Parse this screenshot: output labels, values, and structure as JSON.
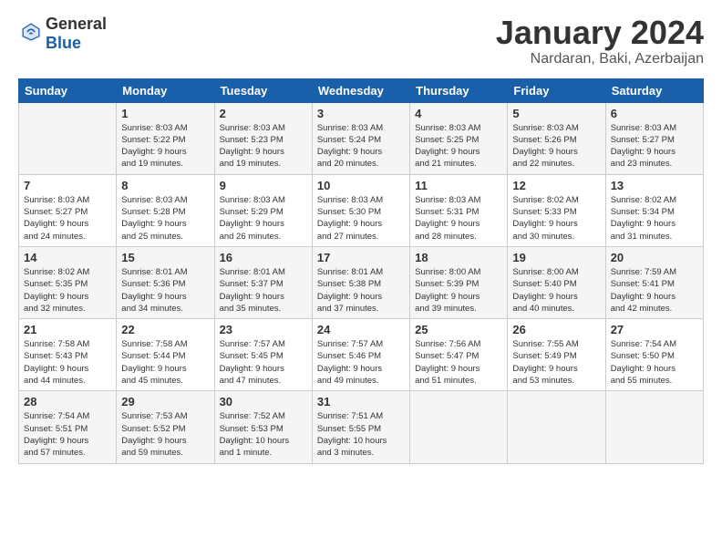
{
  "header": {
    "logo_general": "General",
    "logo_blue": "Blue",
    "month": "January 2024",
    "location": "Nardaran, Baki, Azerbaijan"
  },
  "weekdays": [
    "Sunday",
    "Monday",
    "Tuesday",
    "Wednesday",
    "Thursday",
    "Friday",
    "Saturday"
  ],
  "weeks": [
    [
      {
        "day": "",
        "info": ""
      },
      {
        "day": "1",
        "info": "Sunrise: 8:03 AM\nSunset: 5:22 PM\nDaylight: 9 hours\nand 19 minutes."
      },
      {
        "day": "2",
        "info": "Sunrise: 8:03 AM\nSunset: 5:23 PM\nDaylight: 9 hours\nand 19 minutes."
      },
      {
        "day": "3",
        "info": "Sunrise: 8:03 AM\nSunset: 5:24 PM\nDaylight: 9 hours\nand 20 minutes."
      },
      {
        "day": "4",
        "info": "Sunrise: 8:03 AM\nSunset: 5:25 PM\nDaylight: 9 hours\nand 21 minutes."
      },
      {
        "day": "5",
        "info": "Sunrise: 8:03 AM\nSunset: 5:26 PM\nDaylight: 9 hours\nand 22 minutes."
      },
      {
        "day": "6",
        "info": "Sunrise: 8:03 AM\nSunset: 5:27 PM\nDaylight: 9 hours\nand 23 minutes."
      }
    ],
    [
      {
        "day": "7",
        "info": "Sunrise: 8:03 AM\nSunset: 5:27 PM\nDaylight: 9 hours\nand 24 minutes."
      },
      {
        "day": "8",
        "info": "Sunrise: 8:03 AM\nSunset: 5:28 PM\nDaylight: 9 hours\nand 25 minutes."
      },
      {
        "day": "9",
        "info": "Sunrise: 8:03 AM\nSunset: 5:29 PM\nDaylight: 9 hours\nand 26 minutes."
      },
      {
        "day": "10",
        "info": "Sunrise: 8:03 AM\nSunset: 5:30 PM\nDaylight: 9 hours\nand 27 minutes."
      },
      {
        "day": "11",
        "info": "Sunrise: 8:03 AM\nSunset: 5:31 PM\nDaylight: 9 hours\nand 28 minutes."
      },
      {
        "day": "12",
        "info": "Sunrise: 8:02 AM\nSunset: 5:33 PM\nDaylight: 9 hours\nand 30 minutes."
      },
      {
        "day": "13",
        "info": "Sunrise: 8:02 AM\nSunset: 5:34 PM\nDaylight: 9 hours\nand 31 minutes."
      }
    ],
    [
      {
        "day": "14",
        "info": "Sunrise: 8:02 AM\nSunset: 5:35 PM\nDaylight: 9 hours\nand 32 minutes."
      },
      {
        "day": "15",
        "info": "Sunrise: 8:01 AM\nSunset: 5:36 PM\nDaylight: 9 hours\nand 34 minutes."
      },
      {
        "day": "16",
        "info": "Sunrise: 8:01 AM\nSunset: 5:37 PM\nDaylight: 9 hours\nand 35 minutes."
      },
      {
        "day": "17",
        "info": "Sunrise: 8:01 AM\nSunset: 5:38 PM\nDaylight: 9 hours\nand 37 minutes."
      },
      {
        "day": "18",
        "info": "Sunrise: 8:00 AM\nSunset: 5:39 PM\nDaylight: 9 hours\nand 39 minutes."
      },
      {
        "day": "19",
        "info": "Sunrise: 8:00 AM\nSunset: 5:40 PM\nDaylight: 9 hours\nand 40 minutes."
      },
      {
        "day": "20",
        "info": "Sunrise: 7:59 AM\nSunset: 5:41 PM\nDaylight: 9 hours\nand 42 minutes."
      }
    ],
    [
      {
        "day": "21",
        "info": "Sunrise: 7:58 AM\nSunset: 5:43 PM\nDaylight: 9 hours\nand 44 minutes."
      },
      {
        "day": "22",
        "info": "Sunrise: 7:58 AM\nSunset: 5:44 PM\nDaylight: 9 hours\nand 45 minutes."
      },
      {
        "day": "23",
        "info": "Sunrise: 7:57 AM\nSunset: 5:45 PM\nDaylight: 9 hours\nand 47 minutes."
      },
      {
        "day": "24",
        "info": "Sunrise: 7:57 AM\nSunset: 5:46 PM\nDaylight: 9 hours\nand 49 minutes."
      },
      {
        "day": "25",
        "info": "Sunrise: 7:56 AM\nSunset: 5:47 PM\nDaylight: 9 hours\nand 51 minutes."
      },
      {
        "day": "26",
        "info": "Sunrise: 7:55 AM\nSunset: 5:49 PM\nDaylight: 9 hours\nand 53 minutes."
      },
      {
        "day": "27",
        "info": "Sunrise: 7:54 AM\nSunset: 5:50 PM\nDaylight: 9 hours\nand 55 minutes."
      }
    ],
    [
      {
        "day": "28",
        "info": "Sunrise: 7:54 AM\nSunset: 5:51 PM\nDaylight: 9 hours\nand 57 minutes."
      },
      {
        "day": "29",
        "info": "Sunrise: 7:53 AM\nSunset: 5:52 PM\nDaylight: 9 hours\nand 59 minutes."
      },
      {
        "day": "30",
        "info": "Sunrise: 7:52 AM\nSunset: 5:53 PM\nDaylight: 10 hours\nand 1 minute."
      },
      {
        "day": "31",
        "info": "Sunrise: 7:51 AM\nSunset: 5:55 PM\nDaylight: 10 hours\nand 3 minutes."
      },
      {
        "day": "",
        "info": ""
      },
      {
        "day": "",
        "info": ""
      },
      {
        "day": "",
        "info": ""
      }
    ]
  ]
}
